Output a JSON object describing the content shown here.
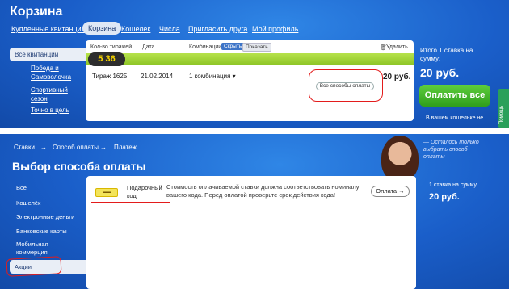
{
  "top": {
    "page_title": "Корзина",
    "nav": [
      "Купленные квитанции",
      "Корзина",
      "Кошелек",
      "Числа",
      "Пригласить друга",
      "Мой профиль"
    ],
    "sidebar": [
      "Все квитанции",
      "Победа и Самоволочка",
      "Спортивный сезон",
      "Точно в цель"
    ],
    "table_headers": {
      "draws": "Кол-во тиражей",
      "date": "Дата",
      "combos": "Комбинации",
      "hide": "Скрыть",
      "show": "Показать",
      "delete": "Удалить"
    },
    "lotto_logo": "5 36",
    "row": {
      "draw": "Тираж 1625",
      "date": "21.02.2014",
      "combos": "1 комбинация ▾",
      "all_methods": "Все способы оплаты",
      "price": "20 руб."
    },
    "summary": {
      "line1": "Итого 1 ставка на",
      "line2": "сумму:",
      "total": "20 руб.",
      "pay_all": "Оплатить все",
      "wallet_note": "В вашем кошельке не",
      "help_tab": "Помощь"
    }
  },
  "bottom": {
    "breadcrumb": [
      "Ставки",
      "→",
      "Способ оплаты",
      "→",
      "Платеж"
    ],
    "page_title": "Выбор способа оплаты",
    "promo_text": "— Осталось только выбрать способ оплаты",
    "sidebar": [
      "Все",
      "Кошелёк",
      "Электронные деньги",
      "Банковские карты",
      "Мобильная коммерция",
      "Акции"
    ],
    "method": {
      "name_line1": "Подарочный",
      "name_line2": "код",
      "desc": "Стоимость оплачиваемой ставки должна соответствовать номиналу вашего кода. Перед оплатой проверьте срок действия кода!",
      "pay_button": "Оплата →"
    },
    "summary": {
      "line": "1 ставка на сумму",
      "total": "20 руб."
    }
  },
  "colors": {
    "bg_blue": "#1a5ec9",
    "accent_green": "#3fb12a",
    "red_mark": "#e31c1c",
    "lime": "#9bd12e"
  }
}
